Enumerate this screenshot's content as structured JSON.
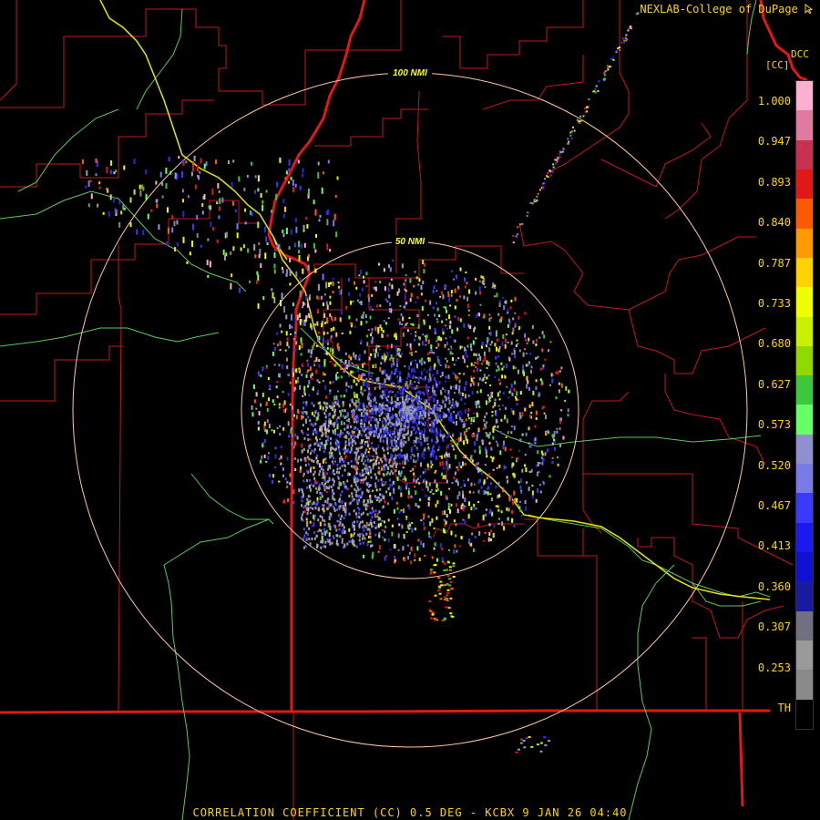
{
  "header": {
    "credit": "NEXLAB-College of DuPage",
    "credit_icon": "cursor-arrow-icon"
  },
  "legend": {
    "product_code": "DCC",
    "unit": "[CC]",
    "ticks": [
      "1.000",
      "0.947",
      "0.893",
      "0.840",
      "0.787",
      "0.733",
      "0.680",
      "0.627",
      "0.573",
      "0.520",
      "0.467",
      "0.413",
      "0.360",
      "0.307",
      "0.253",
      "TH"
    ],
    "colors": [
      "#ffb0d0",
      "#e07aa0",
      "#c83050",
      "#e01818",
      "#ff5a00",
      "#ff9a00",
      "#ffd200",
      "#f0ff00",
      "#c8f000",
      "#90d800",
      "#3cc83c",
      "#66ff66",
      "#9090d0",
      "#7a7ae6",
      "#3a3aff",
      "#1a1aee",
      "#1010d0",
      "#1a1aa0",
      "#707080",
      "#9a9a9a",
      "#8a8a8a",
      "#000000"
    ]
  },
  "rings": [
    {
      "label": "100 NMI"
    },
    {
      "label": "50 NMI"
    }
  ],
  "footer": {
    "caption": "CORRELATION COEFFICIENT (CC) 0.5 DEG - KCBX 9 JAN 26 04:40"
  }
}
